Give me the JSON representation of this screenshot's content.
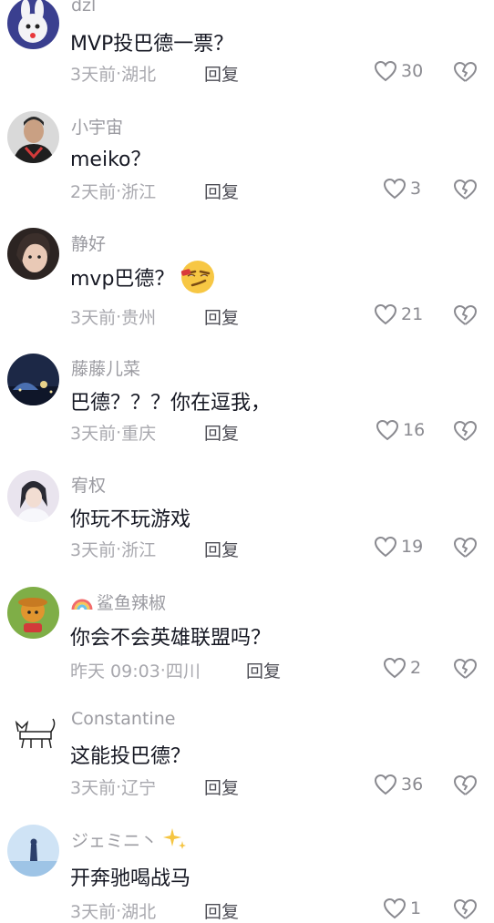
{
  "comments": [
    {
      "user": "dzl",
      "text": "MVP投巴德一票？",
      "time": "3天前",
      "loc": "湖北",
      "reply": "回复",
      "likes": "30"
    },
    {
      "user": "小宇宙",
      "text": "meiko？",
      "time": "2天前",
      "loc": "浙江",
      "reply": "回复",
      "likes": "3"
    },
    {
      "user": "静好",
      "text": "mvp巴德？",
      "time": "3天前",
      "loc": "贵州",
      "reply": "回复",
      "likes": "21"
    },
    {
      "user": "藤藤儿菜",
      "text": "巴德？？？你在逗我，",
      "time": "3天前",
      "loc": "重庆",
      "reply": "回复",
      "likes": "16"
    },
    {
      "user": "宥权",
      "text": "你玩不玩游戏",
      "time": "3天前",
      "loc": "浙江",
      "reply": "回复",
      "likes": "19"
    },
    {
      "user": "鲨鱼辣椒",
      "text": "你会不会英雄联盟吗？",
      "time": "昨天 09:03",
      "loc": "四川",
      "reply": "回复",
      "likes": "2"
    },
    {
      "user": "Constantine",
      "text": "这能投巴德？",
      "time": "3天前",
      "loc": "辽宁",
      "reply": "回复",
      "likes": "36"
    },
    {
      "user": "ジェミニ丶",
      "text": "开奔驰喝战马",
      "time": "3天前",
      "loc": "湖北",
      "reply": "回复",
      "likes": "1"
    }
  ],
  "separator": "·",
  "icons": {
    "like": "heart-outline-icon",
    "dislike": "broken-heart-icon",
    "face": "smirk-face-emoji",
    "rainbow": "rainbow-emoji",
    "sparkles": "sparkles-emoji"
  }
}
